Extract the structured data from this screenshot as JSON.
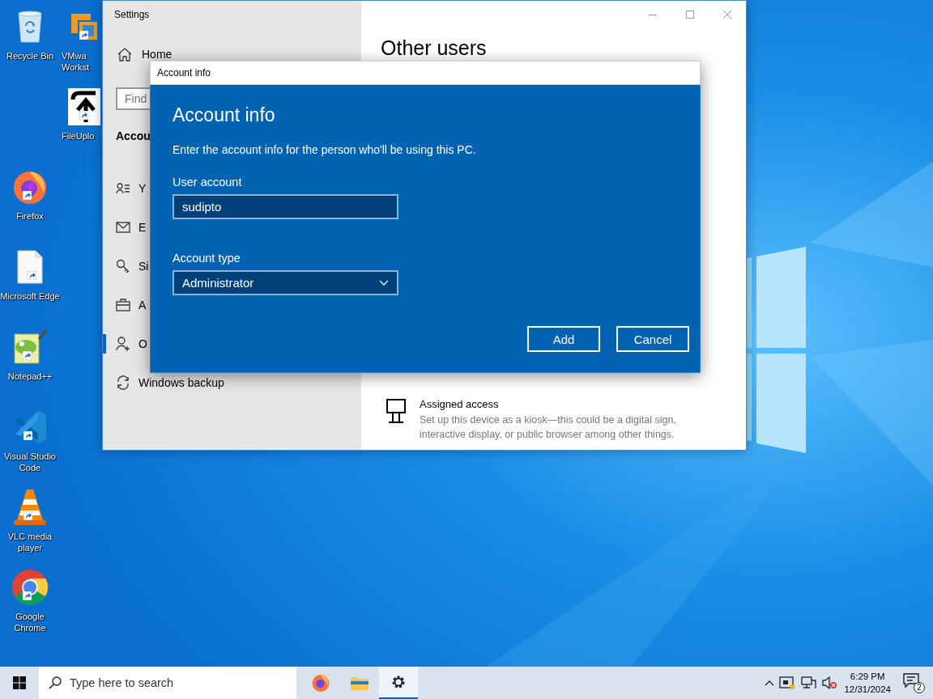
{
  "desktop": {
    "icons": [
      {
        "label": "Recycle Bin",
        "shortcut": false
      },
      {
        "label": "VMwa Workst",
        "shortcut": true
      },
      {
        "label": "FileUplo",
        "shortcut": true
      },
      {
        "label": "Firefox",
        "shortcut": true
      },
      {
        "label": "Microsoft Edge",
        "shortcut": true
      },
      {
        "label": "Notepad++",
        "shortcut": true
      },
      {
        "label": "Visual Studio Code",
        "shortcut": true
      },
      {
        "label": "VLC media player",
        "shortcut": true
      },
      {
        "label": "Google Chrome",
        "shortcut": true
      }
    ]
  },
  "settings": {
    "title": "Settings",
    "home": "Home",
    "search": {
      "placeholder": "Find"
    },
    "section": "Accou",
    "nav": [
      {
        "label": "Y",
        "selected": false
      },
      {
        "label": "E",
        "selected": false
      },
      {
        "label": "Si",
        "selected": false
      },
      {
        "label": "A",
        "selected": false
      },
      {
        "label": "O",
        "selected": true
      },
      {
        "label": "Windows backup",
        "selected": false
      }
    ],
    "heading": "Other users",
    "assigned_access": {
      "title": "Assigned access",
      "description": "Set up this device as a kiosk—this could be a digital sign, interactive display, or public browser among other things."
    }
  },
  "dialog": {
    "window_title": "Account info",
    "heading": "Account info",
    "description": "Enter the account info for the person who'll be using this PC.",
    "user_account": {
      "label": "User account",
      "value": "sudipto"
    },
    "account_type": {
      "label": "Account type",
      "value": "Administrator"
    },
    "buttons": [
      "Add",
      "Cancel"
    ]
  },
  "taskbar": {
    "search": {
      "placeholder": "Type here to search"
    },
    "apps": [
      {
        "selected": false
      },
      {
        "selected": false
      },
      {
        "selected": true
      }
    ],
    "time": "6:29 PM",
    "date": "12/31/2024",
    "notifications": "2"
  }
}
